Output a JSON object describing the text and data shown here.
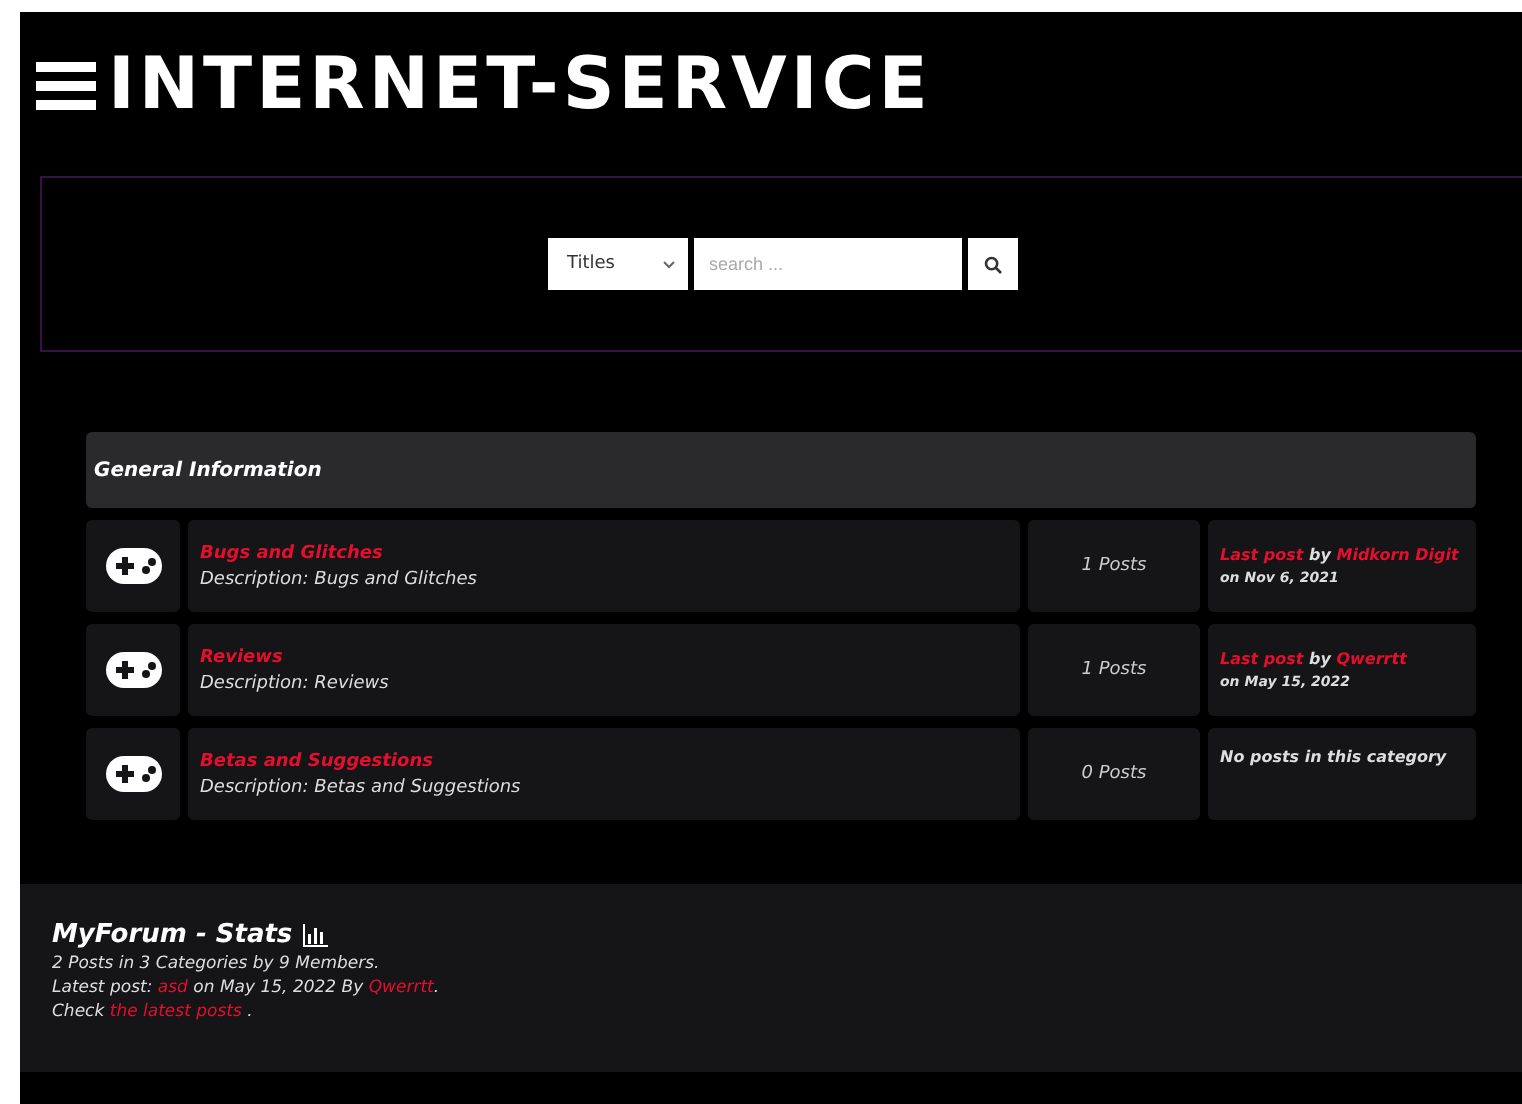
{
  "logo": {
    "text": "INTERNET-SERVICE"
  },
  "search": {
    "filter": "Titles",
    "placeholder": "search ..."
  },
  "category": {
    "title": "General Information",
    "forums": [
      {
        "name": "Bugs and Glitches",
        "description": "Description: Bugs and Glitches",
        "posts": "1 Posts",
        "last": {
          "label": "Last post",
          "by": "by",
          "author": "Midkorn Digit",
          "date": "on Nov 6, 2021"
        }
      },
      {
        "name": "Reviews",
        "description": "Description: Reviews",
        "posts": "1 Posts",
        "last": {
          "label": "Last post",
          "by": "by",
          "author": "Qwerrtt",
          "date": "on May 15, 2022"
        }
      },
      {
        "name": "Betas and Suggestions",
        "description": "Description: Betas and Suggestions",
        "posts": "0 Posts",
        "empty": "No posts in this category"
      }
    ]
  },
  "stats": {
    "title": "MyForum - Stats",
    "lines": [
      [
        {
          "text": "2 Posts in 3 Categories by 9 Members."
        }
      ],
      [
        {
          "text": "Latest post: "
        },
        {
          "text": "asd",
          "link": true
        },
        {
          "text": " on May 15, 2022 By "
        },
        {
          "text": "Qwerrtt",
          "link": true
        },
        {
          "text": "."
        }
      ],
      [
        {
          "text": "Check "
        },
        {
          "text": "the latest posts",
          "link": true
        },
        {
          "text": " ."
        }
      ]
    ]
  }
}
